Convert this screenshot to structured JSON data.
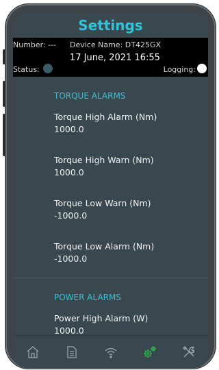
{
  "header": {
    "title": "Settings"
  },
  "status": {
    "number_text": "Number: ---",
    "device_name_text": "Device Name: DT425GX",
    "datetime_text": "17 June, 2021   16:55",
    "status_label": "Status:",
    "logging_label": "Logging:",
    "status_color": "#3a5a6a",
    "logging_color": "#ffffff"
  },
  "sections": {
    "torque": {
      "title": "TORQUE ALARMS",
      "items": [
        {
          "label": "Torque High Alarm (Nm)",
          "value": "1000.0"
        },
        {
          "label": "Torque High Warn (Nm)",
          "value": "1000.0"
        },
        {
          "label": "Torque Low Warn (Nm)",
          "value": "-1000.0"
        },
        {
          "label": "Torque Low Alarm (Nm)",
          "value": "-1000.0"
        }
      ]
    },
    "power": {
      "title": "POWER ALARMS",
      "items": [
        {
          "label": "Power High Alarm (W)",
          "value": "1000.0"
        }
      ]
    }
  },
  "nav": {
    "items": [
      {
        "icon": "home-icon",
        "active": false
      },
      {
        "icon": "document-icon",
        "active": false
      },
      {
        "icon": "wifi-icon",
        "active": false
      },
      {
        "icon": "gears-icon",
        "active": true
      },
      {
        "icon": "tools-icon",
        "active": false
      }
    ],
    "active_color": "#2fb24c",
    "inactive_color": "#9aa6ab"
  }
}
